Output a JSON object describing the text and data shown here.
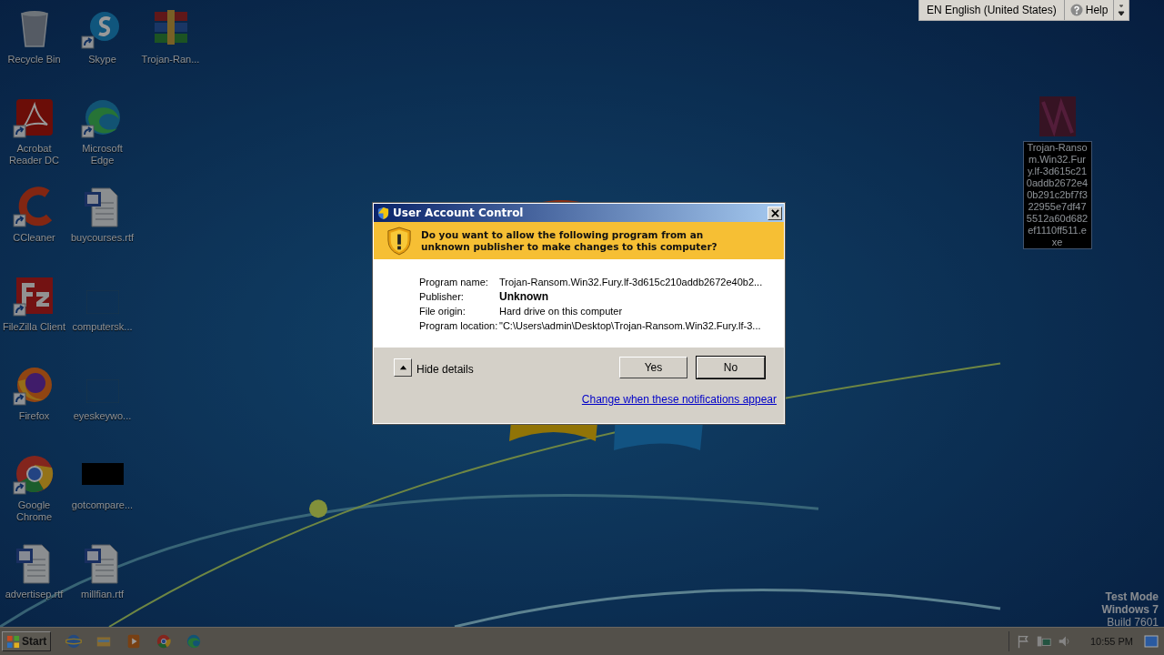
{
  "desktop": {
    "columns": [
      [
        {
          "label": "Recycle Bin",
          "kind": "recycle",
          "shortcut": false,
          "selected": false
        },
        {
          "label": "Acrobat Reader DC",
          "kind": "acrobat",
          "shortcut": true,
          "selected": false
        },
        {
          "label": "CCleaner",
          "kind": "ccleaner",
          "shortcut": true,
          "selected": false
        },
        {
          "label": "FileZilla Client",
          "kind": "filezilla",
          "shortcut": true,
          "selected": false
        },
        {
          "label": "Firefox",
          "kind": "firefox",
          "shortcut": true,
          "selected": false
        },
        {
          "label": "Google Chrome",
          "kind": "chrome",
          "shortcut": true,
          "selected": false
        },
        {
          "label": "advertisep.rtf",
          "kind": "document",
          "shortcut": false,
          "selected": false
        }
      ],
      [
        {
          "label": "Skype",
          "kind": "skype",
          "shortcut": true,
          "selected": false
        },
        {
          "label": "Microsoft Edge",
          "kind": "edge",
          "shortcut": true,
          "selected": false
        },
        {
          "label": "buycourses.rtf",
          "kind": "document",
          "shortcut": false,
          "selected": false
        },
        {
          "label": "computersk...",
          "kind": "blank",
          "shortcut": false,
          "selected": false
        },
        {
          "label": "eyeskeywo...",
          "kind": "blank",
          "shortcut": false,
          "selected": false
        },
        {
          "label": "gotcompare...",
          "kind": "black",
          "shortcut": false,
          "selected": false
        },
        {
          "label": "millfian.rtf",
          "kind": "document",
          "shortcut": false,
          "selected": false
        }
      ],
      [
        {
          "label": "Trojan-Ran...",
          "kind": "archive",
          "shortcut": false,
          "selected": false
        }
      ]
    ],
    "right_icon": {
      "label": "Trojan-Ransom.Win32.Fury.lf-3d615c210addb2672e40b291c2bf7f322955e7df475512a60d682ef1110ff511.exe",
      "kind": "exe",
      "shortcut": false,
      "selected": true
    }
  },
  "language_bar": {
    "language": "EN English (United States)",
    "help": "Help"
  },
  "watermark": [
    "Test Mode",
    "Windows 7",
    "Build 7601"
  ],
  "dialog": {
    "title": "User Account Control",
    "question": "Do you want to allow the following program from an unknown publisher to make changes to this computer?",
    "details": [
      {
        "label": "Program name:",
        "value": "Trojan-Ransom.Win32.Fury.lf-3d615c210addb2672e40b2...",
        "emphasized": false
      },
      {
        "label": "Publisher:",
        "value": "Unknown",
        "emphasized": true
      },
      {
        "label": "File origin:",
        "value": "Hard drive on this computer",
        "emphasized": false
      },
      {
        "label": "Program location:",
        "value": "\"C:\\Users\\admin\\Desktop\\Trojan-Ransom.Win32.Fury.lf-3...",
        "emphasized": false
      }
    ],
    "details_toggle": {
      "label": "Hide details",
      "expanded": true
    },
    "buttons": [
      {
        "label": "Yes",
        "default": false
      },
      {
        "label": "No",
        "default": true
      }
    ],
    "link": "Change when these notifications appear"
  },
  "taskbar": {
    "start": "Start",
    "quick_launch": [
      {
        "kind": "ie"
      },
      {
        "kind": "folder"
      },
      {
        "kind": "media"
      },
      {
        "kind": "chrome"
      },
      {
        "kind": "edge"
      }
    ],
    "tray": [
      {
        "kind": "flag"
      },
      {
        "kind": "network"
      },
      {
        "kind": "speaker"
      }
    ],
    "clock": "10:55 PM"
  }
}
